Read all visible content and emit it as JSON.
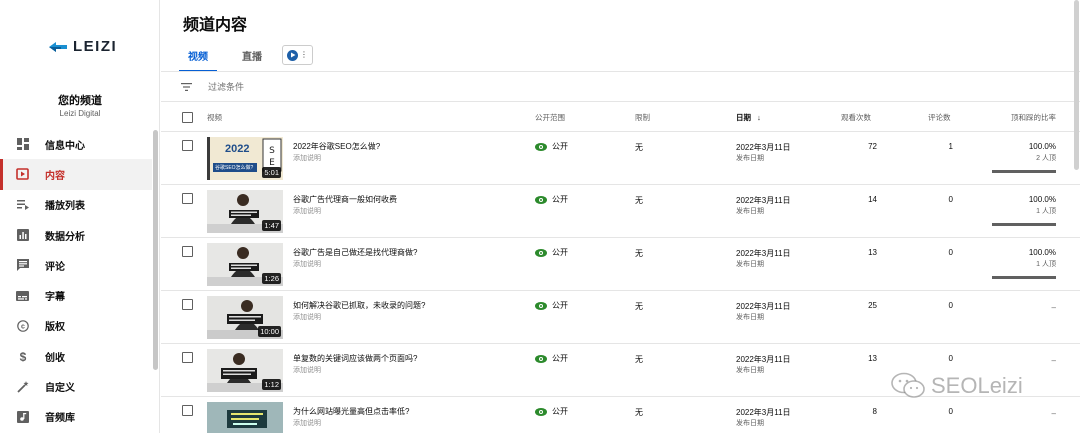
{
  "brand": {
    "logo_text": "LEIZI",
    "accent": "#065fd4",
    "sidebar_active": "#c4302b"
  },
  "channel": {
    "title": "您的频道",
    "name": "Leizi Digital"
  },
  "sidebar": {
    "items": [
      {
        "label": "信息中心",
        "icon": "dashboard-icon"
      },
      {
        "label": "内容",
        "icon": "video-library-icon",
        "active": true
      },
      {
        "label": "播放列表",
        "icon": "playlist-icon"
      },
      {
        "label": "数据分析",
        "icon": "analytics-icon"
      },
      {
        "label": "评论",
        "icon": "comments-icon"
      },
      {
        "label": "字幕",
        "icon": "subtitles-icon"
      },
      {
        "label": "版权",
        "icon": "copyright-icon"
      },
      {
        "label": "创收",
        "icon": "dollar-icon"
      },
      {
        "label": "自定义",
        "icon": "magic-wand-icon"
      },
      {
        "label": "音频库",
        "icon": "audio-library-icon"
      }
    ]
  },
  "header": {
    "title": "频道内容"
  },
  "tabs": [
    {
      "label": "视频",
      "active": true
    },
    {
      "label": "直播"
    }
  ],
  "filter": {
    "placeholder": "过滤条件"
  },
  "table": {
    "columns": {
      "video": "视频",
      "visibility": "公开范围",
      "restrictions": "限制",
      "date": "日期",
      "views": "观看次数",
      "comments": "评论数",
      "likes": "顶和踩的比率"
    },
    "rows": [
      {
        "title": "2022年谷歌SEO怎么做?",
        "description": "添加说明",
        "duration": "5:01",
        "visibility": "公开",
        "restriction": "无",
        "date": "2022年3月11日",
        "date_sub": "发布日期",
        "views": "72",
        "comments": "1",
        "ratio": "100.0%",
        "ratio_sub": "2 人顶",
        "thumb_text": "2022",
        "thumb_sub": "谷歌SEO怎么做?"
      },
      {
        "title": "谷歌广告代理商一般如何收费",
        "description": "添加说明",
        "duration": "1:47",
        "visibility": "公开",
        "restriction": "无",
        "date": "2022年3月11日",
        "date_sub": "发布日期",
        "views": "14",
        "comments": "0",
        "ratio": "100.0%",
        "ratio_sub": "1 人顶"
      },
      {
        "title": "谷歌广告是自己做还是找代理商做?",
        "description": "添加说明",
        "duration": "1:26",
        "visibility": "公开",
        "restriction": "无",
        "date": "2022年3月11日",
        "date_sub": "发布日期",
        "views": "13",
        "comments": "0",
        "ratio": "100.0%",
        "ratio_sub": "1 人顶"
      },
      {
        "title": "如何解决谷歌已抓取，未收录的问题?",
        "description": "添加说明",
        "duration": "10:00",
        "visibility": "公开",
        "restriction": "无",
        "date": "2022年3月11日",
        "date_sub": "发布日期",
        "views": "25",
        "comments": "0",
        "ratio": "–"
      },
      {
        "title": "单复数的关键词应该做两个页面吗?",
        "description": "添加说明",
        "duration": "1:12",
        "visibility": "公开",
        "restriction": "无",
        "date": "2022年3月11日",
        "date_sub": "发布日期",
        "views": "13",
        "comments": "0",
        "ratio": "–"
      },
      {
        "title": "为什么网站曝光量高但点击率低?",
        "description": "添加说明",
        "duration": "",
        "visibility": "公开",
        "restriction": "无",
        "date": "2022年3月11日",
        "date_sub": "发布日期",
        "views": "8",
        "comments": "0",
        "ratio": "–"
      }
    ]
  },
  "watermark": {
    "text": "SEOLeizi"
  }
}
